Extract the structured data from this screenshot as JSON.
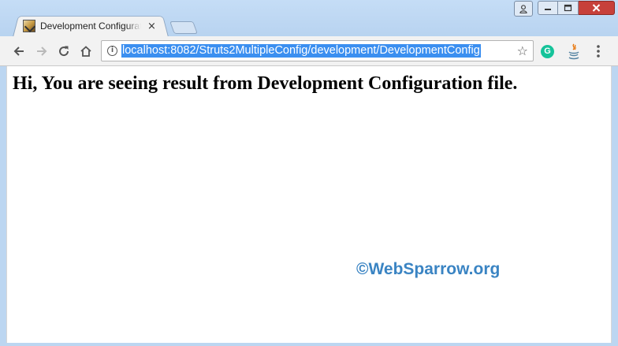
{
  "tab": {
    "title": "Development Configuration",
    "close_glyph": "×"
  },
  "address_bar": {
    "url": "localhost:8082/Struts2MultipleConfig/development/DevelopmentConfig"
  },
  "page": {
    "heading": "Hi, You are seeing result from Development Configuration file.",
    "watermark": "©WebSparrow.org"
  },
  "icons": {
    "back": "back-arrow-icon",
    "forward": "forward-arrow-icon",
    "reload": "reload-icon",
    "home": "home-icon",
    "info": "info-icon",
    "star": "bookmark-star-icon",
    "grammarly": "grammarly-icon",
    "java": "java-icon",
    "menu": "kebab-menu-icon"
  },
  "colors": {
    "frame": "#bcd6f1",
    "url_highlight": "#3b8ff0",
    "watermark": "#3a84c3",
    "close_button": "#c7403a"
  }
}
